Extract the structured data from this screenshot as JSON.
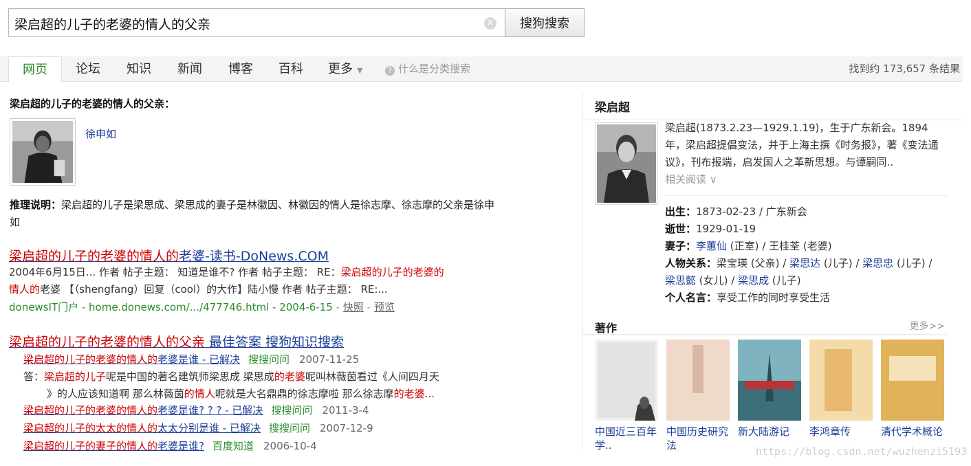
{
  "search": {
    "query": "梁启超的儿子的老婆的情人的父亲",
    "button_label": "搜狗搜索",
    "clear_icon": "clear-icon"
  },
  "tabs": [
    {
      "label": "网页",
      "active": true
    },
    {
      "label": "论坛"
    },
    {
      "label": "知识"
    },
    {
      "label": "新闻"
    },
    {
      "label": "博客"
    },
    {
      "label": "百科"
    },
    {
      "label": "更多"
    }
  ],
  "help_text": "什么是分类搜索",
  "result_count": "找到约 173,657 条结果",
  "answer": {
    "heading": "梁启超的儿子的老婆的情人的父亲：",
    "name": "徐申如",
    "reasoning_label": "推理说明：",
    "reasoning_text": "梁启超的儿子是梁思成、梁思成的妻子是林徽因、林徽因的情人是徐志摩、徐志摩的父亲是徐申如"
  },
  "results": [
    {
      "title_hl": "梁启超的儿子的老婆的情人的",
      "title_rest": "老婆-读书-DoNews.COM",
      "snippet_1": "2004年6月15日... 作者 帖子主题： 知道是谁不? 作者 帖子主题： RE：",
      "snippet_hl_1": "梁启超的儿子的老婆的",
      "snippet_hl_2": "情人的",
      "snippet_2": "老婆 【（shengfang）回复（cool）的大作】陆小慢 作者 帖子主题： RE:...",
      "url": "donewsIT门户 - home.donews.com/.../477746.html - 2004-6-15",
      "cache": "快照",
      "preview": "预览"
    },
    {
      "title_hl": "梁启超的儿子的老婆的情人的父亲",
      "title_rest": " 最佳答案 搜狗知识搜索",
      "subs": [
        {
          "t_hl": "梁启超的儿子的老婆的情人的",
          "t_rest": "老婆是谁 - 已解决",
          "src": "搜搜问问",
          "date": "2007-11-25"
        },
        {
          "t_hl": "梁启超的儿子的老婆的情人的",
          "t_rest": "老婆是谁? ? ? - 已解决",
          "src": "搜搜问问",
          "date": "2011-3-4"
        },
        {
          "t_hl": "梁启超的儿子的太太的情人的",
          "t_rest": "太太分别是谁 - 已解决",
          "src": "搜搜问问",
          "date": "2007-12-9"
        },
        {
          "t_hl": "梁启超的儿子的妻子的情人的",
          "t_rest": "老婆是谁?",
          "src": "百度知道",
          "date": "2006-10-4"
        }
      ],
      "answer_label": "答：",
      "answer_hl_1": "梁启超的儿子",
      "answer_text_1": "呢是中国的著名建筑师梁思成 梁思成",
      "answer_hl_2": "的老婆",
      "answer_text_2": "呢叫林薇茵看过《人间四月天",
      "answer_line2_a": "》的人应该知道啊 那么林薇茵",
      "answer_hl_3": "的情人",
      "answer_line2_b": "呢就是大名鼎鼎的徐志摩啦 那么徐志摩",
      "answer_hl_4": "的老婆...",
      "answer_text_end": ""
    }
  ],
  "knowledge": {
    "title": "梁启超",
    "summary": "梁启超(1873.2.23—1929.1.19)，生于广东新会。1894年，梁启超提倡变法，并于上海主撰《时务报》，著《变法通议》，刊布报端，启发国人之革新思想。与谭嗣同..",
    "more": "相关阅读 ∨",
    "birth_label": "出生：",
    "birth": "1873-02-23 / 广东新会",
    "death_label": "逝世：",
    "death": "1929-01-19",
    "wife_label": "妻子：",
    "wife_1": "李蕙仙",
    "wife_1_note": " (正室) / ",
    "wife_2": "王桂荃",
    "wife_2_note": " (老婆)",
    "relations_label": "人物关系：",
    "rel_1": "梁宝瑛 (父亲) / ",
    "rel_2": "梁思达",
    "rel_2_note": " (儿子) / ",
    "rel_3": "梁思忠",
    "rel_3_note": " (儿子) / ",
    "rel_4": "梁思懿",
    "rel_4_note": " (女儿) / ",
    "rel_5": "梁思成",
    "rel_5_note": " (儿子)",
    "quote_label": "个人名言：",
    "quote": "享受工作的同时享受生活",
    "works_title": "著作",
    "works_more": "更多>>",
    "books": [
      {
        "title": "中国近三百年学..",
        "cover_color": "#e8e8e8"
      },
      {
        "title": "中国历史研究法",
        "cover_color": "#f0d9c9"
      },
      {
        "title": "新大陆游记",
        "cover_color": "#4f8f9c"
      },
      {
        "title": "李鸿章传",
        "cover_color": "#e4b36a"
      },
      {
        "title": "清代学术概论",
        "cover_color": "#d9a246"
      }
    ]
  },
  "watermark": "https://blog.csdn.net/wuzhenzi5193"
}
